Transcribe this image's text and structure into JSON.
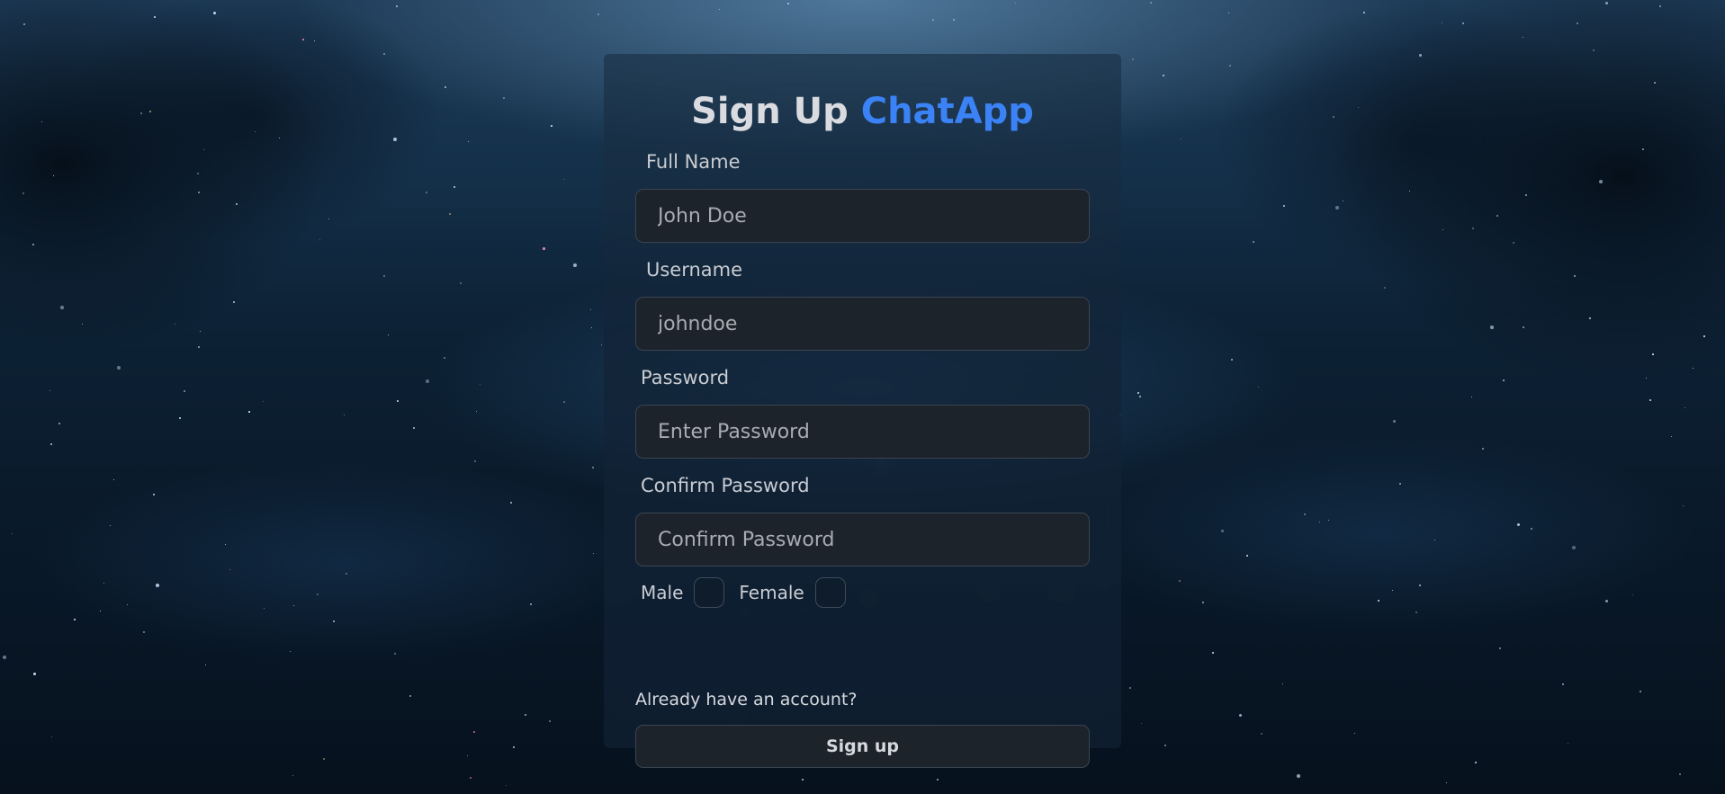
{
  "form": {
    "title_prefix": "Sign Up",
    "title_brand": "ChatApp",
    "brand_color": "#3b82f6",
    "fields": {
      "full_name": {
        "label": "Full Name",
        "placeholder": "John Doe",
        "value": ""
      },
      "username": {
        "label": "Username",
        "placeholder": "johndoe",
        "value": ""
      },
      "password": {
        "label": "Password",
        "placeholder": "Enter Password",
        "value": ""
      },
      "confirm_password": {
        "label": "Confirm Password",
        "placeholder": "Confirm Password",
        "value": ""
      }
    },
    "gender": {
      "male_label": "Male",
      "female_label": "Female"
    },
    "login_link": "Already have an account?",
    "submit_label": "Sign up"
  }
}
